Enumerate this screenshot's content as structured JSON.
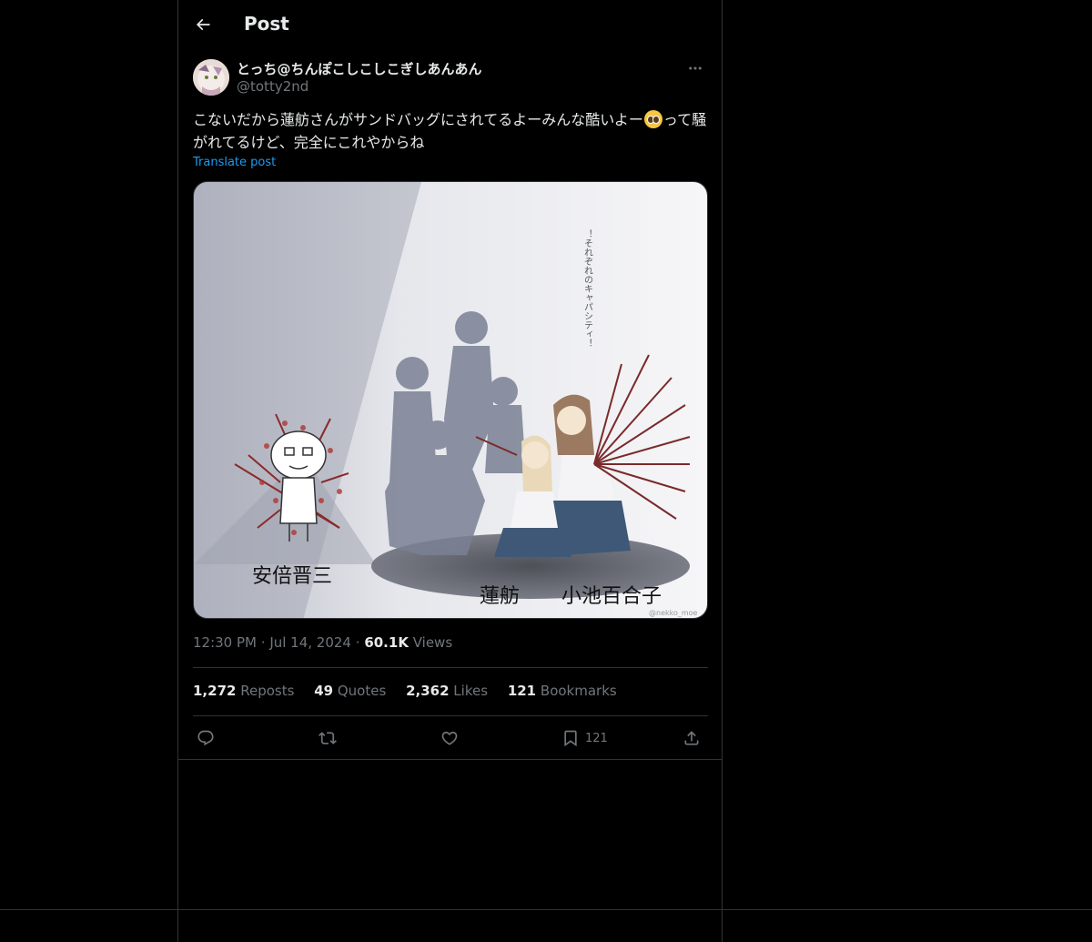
{
  "header": {
    "title": "Post",
    "back_icon": "arrow-left-icon"
  },
  "author": {
    "display_name": "とっち@ちんぽこしこしこぎしあんあん",
    "handle": "@totty2nd",
    "more_icon": "more-horizontal-icon"
  },
  "post": {
    "text_part1": "こないだから蓮舫さんがサンドバッグにされてるよーみんな酷いよー",
    "emoji_icon": "pleading-face-emoji",
    "text_part2": "って騒がれてるけど、完全にこれやからね",
    "translate_label": "Translate post"
  },
  "media": {
    "vertical_caption": "！それぞれのキャパシティ！",
    "label_abe": "安倍晋三",
    "label_renho": "蓮舫",
    "label_koike": "小池百合子",
    "watermark": "@nekko_moe"
  },
  "meta": {
    "time": "12:30 PM",
    "date": "Jul 14, 2024",
    "views_count": "60.1K",
    "views_label": "Views"
  },
  "stats": {
    "reposts_count": "1,272",
    "reposts_label": "Reposts",
    "quotes_count": "49",
    "quotes_label": "Quotes",
    "likes_count": "2,362",
    "likes_label": "Likes",
    "bookmarks_count": "121",
    "bookmarks_label": "Bookmarks"
  },
  "actions": {
    "reply_icon": "reply-icon",
    "repost_icon": "repost-icon",
    "like_icon": "heart-icon",
    "bookmark_icon": "bookmark-icon",
    "bookmark_count": "121",
    "share_icon": "share-icon"
  },
  "colors": {
    "background": "#000000",
    "text_primary": "#e7e9ea",
    "text_secondary": "#71767b",
    "link": "#1d9bf0",
    "border": "#2f3336"
  }
}
